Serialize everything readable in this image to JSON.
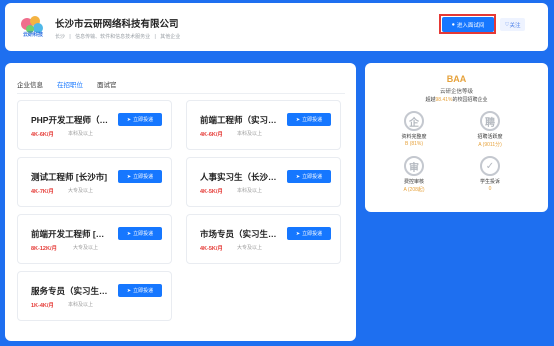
{
  "header": {
    "logo_text": "云研科技",
    "company_name": "长沙市云研网络科技有限公司",
    "tags": [
      "长沙",
      "|",
      "信息传输、软件和信息技术服务业",
      "|",
      "其他企业"
    ],
    "enter_button": "进入面试间",
    "follow_button": "关注"
  },
  "tabs": [
    {
      "label": "企业信息",
      "active": false
    },
    {
      "label": "在招职位",
      "active": true
    },
    {
      "label": "面试官",
      "active": false
    }
  ],
  "jobs": [
    {
      "title": "PHP开发工程师（实...",
      "salary": "4K-6K/月",
      "edu": "本科及以上",
      "button": "立即投递"
    },
    {
      "title": "前端工程师（实习生...",
      "salary": "4K-6K/月",
      "edu": "本科及以上",
      "button": "立即投递"
    },
    {
      "title": "测试工程师 [长沙市]",
      "salary": "4K-7K/月",
      "edu": "大专及以上",
      "button": "立即投递"
    },
    {
      "title": "人事实习生（长沙）[...",
      "salary": "4K-5K/月",
      "edu": "本科及以上",
      "button": "立即投递"
    },
    {
      "title": "前端开发工程师 [长沙...",
      "salary": "8K-12K/月",
      "edu": "大专及以上",
      "button": "立即投递"
    },
    {
      "title": "市场专员（实习生）...",
      "salary": "4K-5K/月",
      "edu": "大专及以上",
      "button": "立即投递"
    },
    {
      "title": "服务专员（实习生）[...",
      "salary": "1K-4K/月",
      "edu": "本科及以上",
      "button": "立即投递"
    }
  ],
  "side": {
    "grade": "BAA",
    "grade_sub": "云研企信等级",
    "grade_desc_pre": "超越",
    "grade_desc_pct": "98.41%",
    "grade_desc_post": "的校园招聘企业",
    "metrics": [
      {
        "icon": "企",
        "label": "资料完整度",
        "value": "B (81%)"
      },
      {
        "icon": "聘",
        "label": "招聘活跃度",
        "value": "A (9011分)"
      },
      {
        "icon": "审",
        "label": "费控审核",
        "value": "A (208起)"
      },
      {
        "icon": "✓",
        "label": "学生投诉",
        "value": "0"
      }
    ]
  },
  "colors": {
    "accent": "#1677ff",
    "salary": "#e53935",
    "grade": "#e6a23c",
    "background": "#1e6ff0"
  }
}
